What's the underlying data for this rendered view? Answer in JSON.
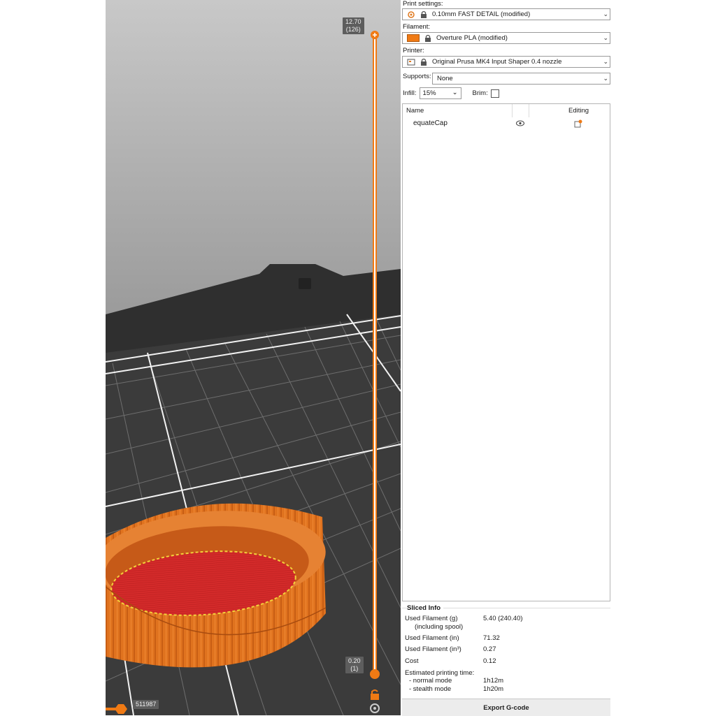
{
  "viewport": {
    "vertical_slider": {
      "top_label": "12.70",
      "top_layer": "(126)",
      "bottom_label": "0.20",
      "bottom_layer": "(1)"
    },
    "horizontal_slider": {
      "value": "511987"
    }
  },
  "panel": {
    "print_settings": {
      "label": "Print settings:",
      "value": "0.10mm FAST DETAIL (modified)"
    },
    "filament": {
      "label": "Filament:",
      "value": "Overture PLA (modified)",
      "color": "#f07a14"
    },
    "printer": {
      "label": "Printer:",
      "value": "Original Prusa MK4 Input Shaper 0.4 nozzle"
    },
    "supports": {
      "label": "Supports:",
      "value": "None"
    },
    "infill": {
      "label": "Infill:",
      "value": "15%"
    },
    "brim": {
      "label": "Brim:",
      "checked": false
    },
    "object_list": {
      "col_name": "Name",
      "col_editing": "Editing",
      "items": [
        {
          "name": "equateCap"
        }
      ]
    },
    "sliced_info": {
      "title": "Sliced Info",
      "used_filament_g_label": "Used Filament (g)",
      "used_filament_g_sub": "(including spool)",
      "used_filament_g_value": "5.40 (240.40)",
      "used_filament_in_label": "Used Filament (in)",
      "used_filament_in_value": "71.32",
      "used_filament_in3_label": "Used Filament (in³)",
      "used_filament_in3_value": "0.27",
      "cost_label": "Cost",
      "cost_value": "0.12",
      "time_label": "Estimated printing time:",
      "normal_label": "- normal mode",
      "normal_value": "1h12m",
      "stealth_label": "- stealth mode",
      "stealth_value": "1h20m"
    },
    "export_button": "Export G-code"
  }
}
